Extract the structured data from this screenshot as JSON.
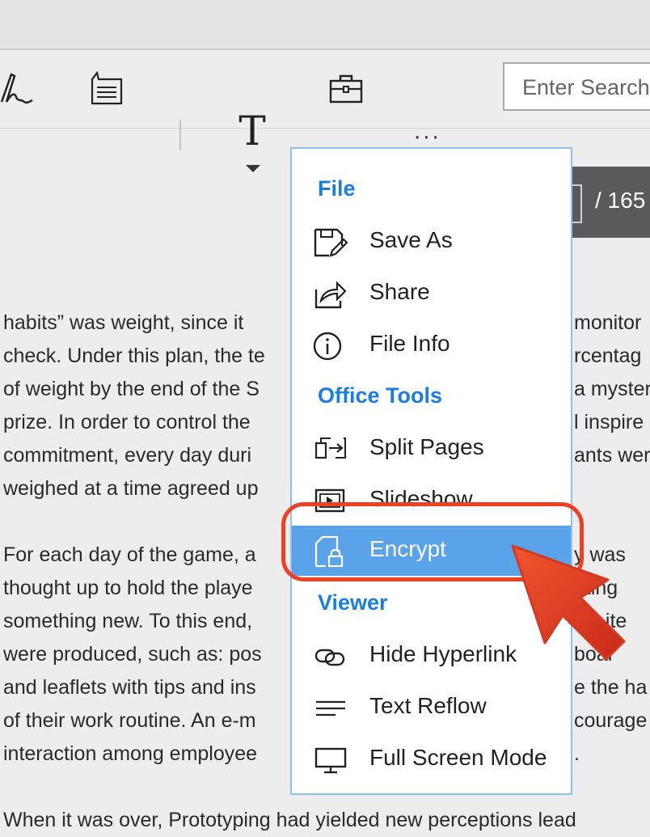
{
  "toolbar": {
    "icons": [
      "signature-icon",
      "note-icon",
      "text-icon",
      "briefcase-icon",
      "more-icon"
    ],
    "text_tool_glyph": "T",
    "more_glyph": "···",
    "search_placeholder": "Enter Search"
  },
  "page_nav": {
    "total": "/ 165"
  },
  "document": {
    "paragraph1": [
      "habits” was weight, since it",
      "check. Under this plan, the te",
      "of weight by the end of the S",
      "prize. In order to control the",
      "commitment, every day duri",
      "weighed at a time agreed up"
    ],
    "paragraph1_right": [
      "monitor",
      "rcentag",
      "a myster",
      "l inspire",
      "ants wer",
      ""
    ],
    "paragraph2": [
      "For each day of the game, a",
      "thought up to hold the playe",
      "something new. To this end,",
      "were produced, such as: pos",
      "and leaflets with tips and ins",
      "of their work routine. An e-m",
      "interaction among employee"
    ],
    "paragraph2_right": [
      "y was",
      "nting",
      "hic ite",
      "boar",
      "e the ha",
      "courage",
      "."
    ],
    "last_line": "When it was over, Prototyping had yielded new perceptions lead"
  },
  "menu": {
    "sections": [
      {
        "title": "File",
        "items": [
          {
            "label": "Save As",
            "icon": "save-as-icon"
          },
          {
            "label": "Share",
            "icon": "share-icon"
          },
          {
            "label": "File Info",
            "icon": "info-icon"
          }
        ]
      },
      {
        "title": "Office Tools",
        "items": [
          {
            "label": "Split Pages",
            "icon": "split-pages-icon"
          },
          {
            "label": "Slideshow",
            "icon": "slideshow-icon"
          },
          {
            "label": "Encrypt",
            "icon": "lock-file-icon",
            "selected": true
          }
        ]
      },
      {
        "title": "Viewer",
        "items": [
          {
            "label": "Hide Hyperlink",
            "icon": "link-icon"
          },
          {
            "label": "Text Reflow",
            "icon": "reflow-icon"
          },
          {
            "label": "Full Screen Mode",
            "icon": "monitor-icon"
          }
        ]
      }
    ]
  },
  "colors": {
    "accent": "#1a7ee0",
    "selected": "#5aa3e9",
    "highlight": "#f04024",
    "cursor": "#e8432a"
  }
}
